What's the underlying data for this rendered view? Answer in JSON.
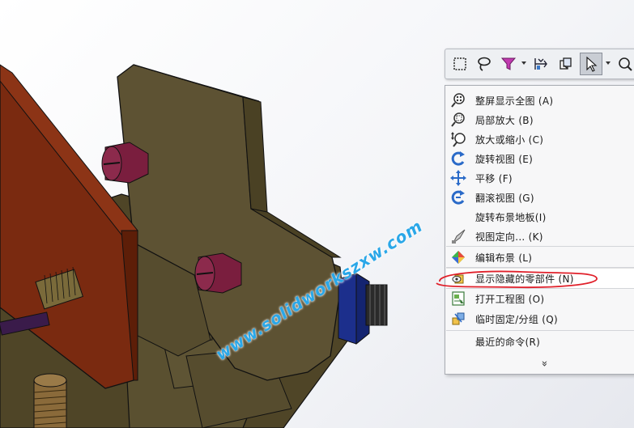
{
  "toolbar": {
    "buttons": [
      {
        "name": "box-select",
        "icon": "box-select-icon",
        "active": false
      },
      {
        "name": "lasso-select",
        "icon": "lasso-icon",
        "active": false
      },
      {
        "name": "selection-filter",
        "icon": "filter-icon",
        "active": false
      },
      {
        "name": "move-component",
        "icon": "move-component-icon",
        "active": false
      },
      {
        "name": "rotate-component",
        "icon": "rotate-component-icon",
        "active": false
      },
      {
        "name": "select",
        "icon": "arrow-cursor-icon",
        "active": true
      },
      {
        "name": "magnify-selected",
        "icon": "magnifier-icon",
        "active": false
      }
    ]
  },
  "context_menu": {
    "items": [
      {
        "label": "整屏显示全图 (A)",
        "icon": "zoom-to-fit-icon"
      },
      {
        "label": "局部放大 (B)",
        "icon": "zoom-to-area-icon"
      },
      {
        "label": "放大或缩小 (C)",
        "icon": "zoom-in-out-icon"
      },
      {
        "label": "旋转视图 (E)",
        "icon": "rotate-view-icon"
      },
      {
        "label": "平移 (F)",
        "icon": "pan-icon"
      },
      {
        "label": "翻滚视图 (G)",
        "icon": "roll-view-icon"
      },
      {
        "label": "旋转布景地板(I)",
        "icon": ""
      },
      {
        "label": "视图定向... (K)",
        "icon": "view-orientation-icon"
      },
      {
        "label": "编辑布景 (L)",
        "icon": "edit-scene-icon"
      },
      {
        "label": "显示隐藏的零部件 (N)",
        "icon": "show-hidden-components-icon"
      },
      {
        "label": "打开工程图 (O)",
        "icon": "open-drawing-icon"
      },
      {
        "label": "临时固定/分组 (Q)",
        "icon": "temporary-fix-group-icon"
      },
      {
        "label": "最近的命令(R)",
        "icon": ""
      }
    ],
    "more_glyph": "»"
  },
  "watermark": "www.solidworkszxw.com",
  "colors": {
    "accent": "#2aa7e8",
    "annotation_red": "#e0202a",
    "body_olive": "#5d5233",
    "jaw_red": "#7a2a10",
    "screw_magenta": "#7a1e3e",
    "nut_blue": "#1c2f8c"
  }
}
